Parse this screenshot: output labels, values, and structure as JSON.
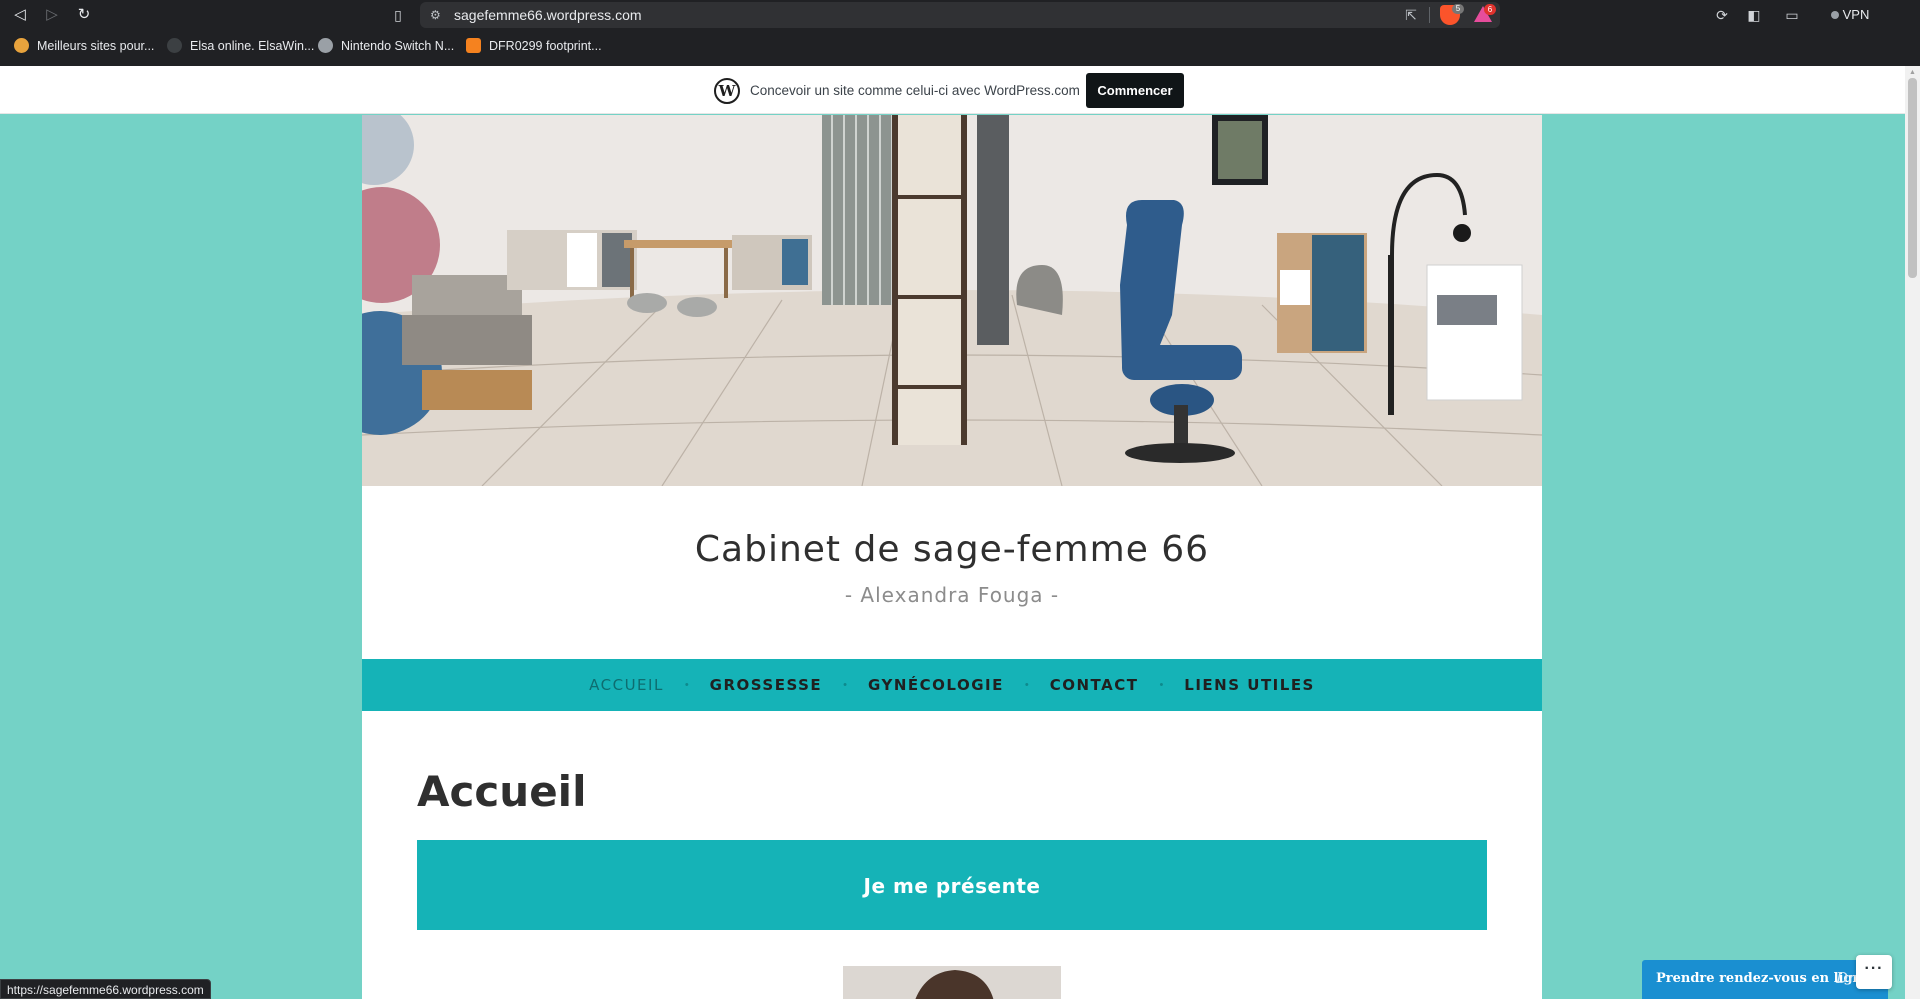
{
  "browser": {
    "url": "sagefemme66.wordpress.com",
    "brave_badge": "5",
    "rewards_badge": "6",
    "vpn_label": "VPN",
    "bookmarks": [
      {
        "label": "Meilleurs sites pour..."
      },
      {
        "label": "Elsa online. ElsaWin..."
      },
      {
        "label": "Nintendo Switch N..."
      },
      {
        "label": "DFR0299 footprint..."
      }
    ],
    "status_url": "https://sagefemme66.wordpress.com"
  },
  "wp_banner": {
    "text": "Concevoir un site comme celui-ci avec WordPress.com",
    "cta": "Commencer"
  },
  "site": {
    "title": "Cabinet de sage-femme 66",
    "tagline": "- Alexandra Fouga -",
    "nav": [
      {
        "label": "ACCUEIL",
        "current": true
      },
      {
        "label": "GROSSESSE"
      },
      {
        "label": "GYNÉCOLOGIE"
      },
      {
        "label": "CONTACT"
      },
      {
        "label": "LIENS UTILES"
      }
    ]
  },
  "content": {
    "page_title": "Accueil",
    "cover_heading": "Je me présente"
  },
  "widgets": {
    "rdv_label": "Prendre rendez-vous en ligne",
    "rdv_sign": "Dr",
    "more_label": "···"
  },
  "colors": {
    "page_background": "#74d2c6",
    "accent_teal": "#15b3b7",
    "wp_button": "#101517",
    "rdv_blue": "#1a8fd1"
  }
}
